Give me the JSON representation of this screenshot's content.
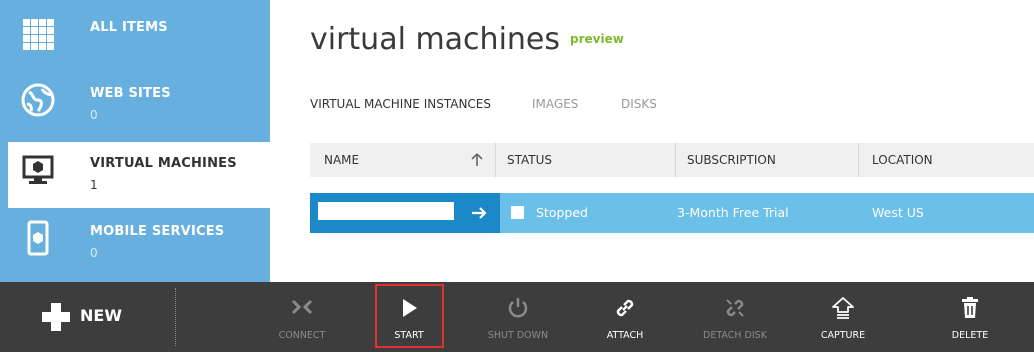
{
  "sidebar": {
    "items": [
      {
        "label": "ALL ITEMS",
        "count": "",
        "icon": "grid-icon"
      },
      {
        "label": "WEB SITES",
        "count": "0",
        "icon": "globe-icon"
      },
      {
        "label": "VIRTUAL MACHINES",
        "count": "1",
        "icon": "monitor-icon"
      },
      {
        "label": "MOBILE SERVICES",
        "count": "0",
        "icon": "mobile-icon"
      }
    ]
  },
  "main": {
    "title": "virtual machines",
    "badge": "preview",
    "tabs": [
      "VIRTUAL MACHINE INSTANCES",
      "IMAGES",
      "DISKS"
    ],
    "columns": [
      "NAME",
      "STATUS",
      "SUBSCRIPTION",
      "LOCATION"
    ],
    "rows": [
      {
        "status": "Stopped",
        "subscription": "3-Month Free Trial",
        "location": "West US"
      }
    ]
  },
  "commandbar": {
    "new_label": "NEW",
    "commands": [
      {
        "label": "CONNECT",
        "icon": "connect-icon",
        "enabled": false
      },
      {
        "label": "START",
        "icon": "play-icon",
        "enabled": true
      },
      {
        "label": "SHUT DOWN",
        "icon": "power-icon",
        "enabled": false
      },
      {
        "label": "ATTACH",
        "icon": "link-icon",
        "enabled": true
      },
      {
        "label": "DETACH DISK",
        "icon": "broken-link-icon",
        "enabled": false
      },
      {
        "label": "CAPTURE",
        "icon": "capture-icon",
        "enabled": true
      },
      {
        "label": "DELETE",
        "icon": "trash-icon",
        "enabled": true
      }
    ]
  },
  "colors": {
    "sidebar_bg": "#67afdf",
    "selected_row": "#6bc0e9",
    "selected_name_cell": "#1b88c7",
    "commandbar_bg": "#3d3d3d",
    "preview_badge": "#7fb82c",
    "highlight_border": "#e03030"
  }
}
